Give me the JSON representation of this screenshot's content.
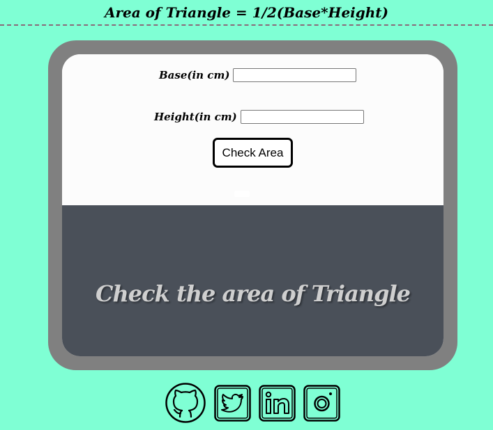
{
  "header": {
    "title": "Area of Triangle = 1/2(Base*Height)"
  },
  "form": {
    "base_label": "Base(in cm)",
    "base_value": "",
    "height_label": "Height(in cm)",
    "height_value": "",
    "check_label": "Check Area",
    "output_text": ""
  },
  "banner": {
    "text": "Check the area of Triangle"
  },
  "socials": [
    {
      "icon": "github-icon"
    },
    {
      "icon": "twitter-icon"
    },
    {
      "icon": "linkedin-icon"
    },
    {
      "icon": "instagram-icon"
    }
  ],
  "colors": {
    "background": "#7fffd4",
    "frame": "#808080",
    "banner": "#4a5059",
    "banner_text": "#cfcfcf"
  }
}
